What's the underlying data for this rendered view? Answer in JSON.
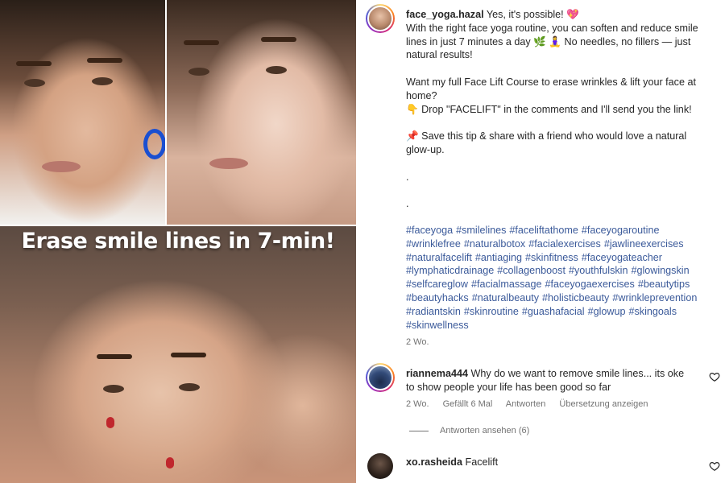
{
  "media": {
    "overlay_title": "Erase smile lines in 7-min!"
  },
  "post": {
    "username": "face_yoga.hazal",
    "caption_lines": [
      "Yes, it's possible! 💖",
      "With the right face yoga routine, you can soften and reduce smile",
      "lines in just 7 minutes a day 🌿 🧘‍♀️ No needles, no fillers — just",
      "natural results!",
      "",
      "Want my full Face Lift Course to erase wrinkles & lift your face at",
      "home?",
      "👇 Drop \"FACELIFT\" in the comments and I'll send you the link!",
      "",
      "📌 Save this tip & share with a friend who would love a natural",
      "glow-up.",
      "",
      ".",
      "",
      "."
    ],
    "hashtags": [
      "#faceyoga",
      "#smilelines",
      "#faceliftathome",
      "#faceyogaroutine",
      "#wrinklefree",
      "#naturalbotox",
      "#facialexercises",
      "#jawlineexercises",
      "#naturalfacelift",
      "#antiaging",
      "#skinfitness",
      "#faceyogateacher",
      "#lymphaticdrainage",
      "#collagenboost",
      "#youthfulskin",
      "#glowingskin",
      "#selfcareglow",
      "#facialmassage",
      "#faceyogaexercises",
      "#beautytips",
      "#beautyhacks",
      "#naturalbeauty",
      "#holisticbeauty",
      "#wrinkleprevention",
      "#radiantskin",
      "#skinroutine",
      "#guashafacial",
      "#glowup",
      "#skingoals",
      "#skinwellness"
    ],
    "time": "2 Wo."
  },
  "comments": [
    {
      "username": "riannema444",
      "text_line1": "Why do we want to remove smile lines... its oke",
      "text_line2": "to show people your life has been good so far",
      "time": "2 Wo.",
      "likes": "Gefällt 6 Mal",
      "reply": "Antworten",
      "translate": "Übersetzung anzeigen",
      "view_replies": "Antworten ansehen (6)"
    },
    {
      "username": "xo.rasheida",
      "text_line1": "Facelift"
    }
  ],
  "icons": {
    "like": "heart-outline-icon"
  },
  "colors": {
    "hashtag": "#3b5a9a",
    "meta": "#737373",
    "text": "#262626",
    "earring": "#1a4fd1"
  }
}
